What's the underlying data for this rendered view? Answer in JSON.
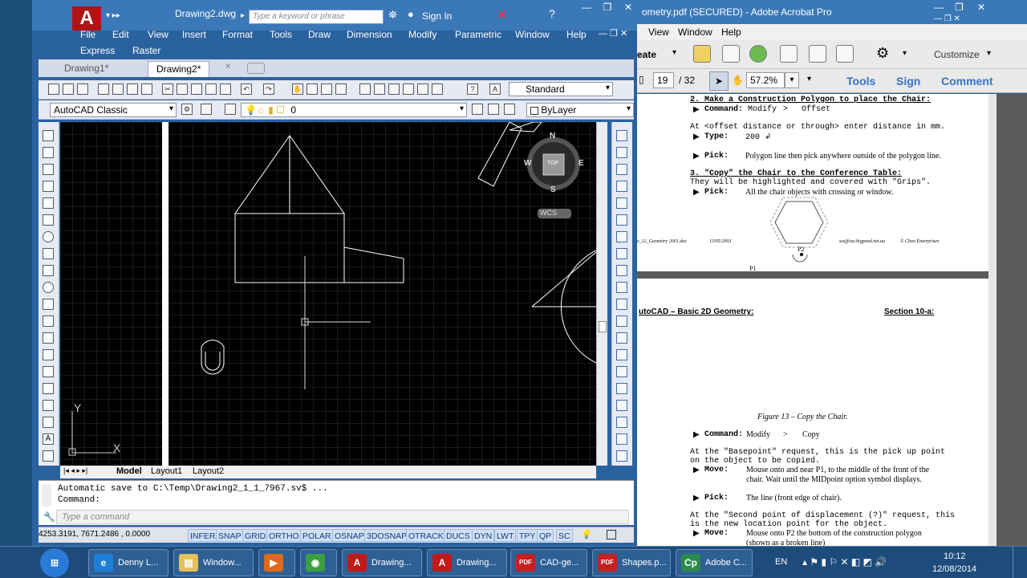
{
  "acad": {
    "doc_title": "Drawing2.dwg",
    "search_placeholder": "Type a keyword or phrase",
    "sign_in": "Sign In",
    "menu_row1": [
      "File",
      "Edit",
      "View",
      "Insert",
      "Format",
      "Tools",
      "Draw",
      "Dimension",
      "Modify",
      "Parametric",
      "Window",
      "Help"
    ],
    "menu_row2": [
      "Express",
      "Raster"
    ],
    "tabs": [
      "Drawing1*",
      "Drawing2*"
    ],
    "text_style": "Standard",
    "workspace": "AutoCAD Classic",
    "layer": "0",
    "color": "ByLayer",
    "viewcube": {
      "n": "N",
      "s": "S",
      "e": "E",
      "w": "W",
      "top": "TOP",
      "wcs": "WCS"
    },
    "ucs": {
      "x": "X",
      "y": "Y"
    },
    "layout_tabs": [
      "Model",
      "Layout1",
      "Layout2"
    ],
    "command_history": [
      "Automatic save to C:\\Temp\\Drawing2_1_1_7967.sv$ ...",
      "Command:"
    ],
    "command_placeholder": "Type a command",
    "coords": "4253.3191, 7671.2486 , 0.0000",
    "status_buttons": [
      "INFER",
      "SNAP",
      "GRID",
      "ORTHO",
      "POLAR",
      "OSNAP",
      "3DOSNAP",
      "OTRACK",
      "DUCS",
      "DYN",
      "LWT",
      "TPY",
      "QP",
      "SC"
    ]
  },
  "acro": {
    "title": "ometry.pdf (SECURED) - Adobe Acrobat Pro",
    "menu": [
      "View",
      "Window",
      "Help"
    ],
    "create_label": "eate",
    "customize": "Customize",
    "page_current": "19",
    "page_total": "/ 32",
    "zoom": "57.2%",
    "links": [
      "Tools",
      "Sign",
      "Comment"
    ],
    "page1": {
      "l1": "2. Make a Construction Polygon to place the Chair:",
      "l2a": "Command:",
      "l2b": "Modify",
      "l2c": ">",
      "l2d": "Offset",
      "l3": "At <offset distance or through> enter distance in mm.",
      "l4a": "Type:",
      "l4b": "200 ↲",
      "l5a": "Pick:",
      "l5b": "Polygon line then pick anywhere outside of the polygon line.",
      "l6": "3. \"Copy\" the Chair to the Conference Table:",
      "l7": "They will be highlighted and covered with \"Grips\".",
      "l8a": "Pick:",
      "l8b": "All the chair objects with crossing or window.",
      "p2": "P2",
      "p1": "P1",
      "footer1": "e_12_Geometry 2001.doc",
      "footer2": "13/05/2003",
      "footer3": "sss@sss.bigpond.net.au",
      "footer4": "© Choo Enterprises"
    },
    "page2": {
      "header_left": "utoCAD – Basic 2D Geometry:",
      "header_right": "Section 10-a:",
      "figure": "Figure 13 – Copy the Chair.",
      "c1a": "Command:",
      "c1b": "Modify",
      "c1c": ">",
      "c1d": "Copy",
      "c2": "At the \"Basepoint\" request, this is the pick up point",
      "c3": "on the object to be copied.",
      "c4a": "Move:",
      "c4b": "Mouse onto and near P1, to the middle of the front of the",
      "c4c": "chair. Wait until the MIDpoint option symbol displays.",
      "c5a": "Pick:",
      "c5b": "The line (front edge of chair).",
      "c6": "At the \"Second point of displacement (?)\" request, this",
      "c7": "is the new location point for the object.",
      "c8a": "Move:",
      "c8b": "Mouse onto P2 the bottom of the construction polygon",
      "c8c": "(shown as a broken line)"
    }
  },
  "taskbar": {
    "items": [
      {
        "label": "Denny L...",
        "icon": "e",
        "color": "#1e7fd8"
      },
      {
        "label": "Window...",
        "icon": "▤",
        "color": "#e4c15a"
      },
      {
        "label": "",
        "icon": "▶",
        "color": "#e06a1a"
      },
      {
        "label": "",
        "icon": "◉",
        "color": "#3aa040"
      },
      {
        "label": "Drawing...",
        "icon": "A",
        "color": "#c11a1a"
      },
      {
        "label": "Drawing...",
        "icon": "A",
        "color": "#c11a1a"
      },
      {
        "label": "CAD-ge...",
        "icon": "PDF",
        "color": "#c42020"
      },
      {
        "label": "Shapes.p...",
        "icon": "PDF",
        "color": "#c42020"
      },
      {
        "label": "Adobe C...",
        "icon": "Cp",
        "color": "#2a8a4a"
      }
    ],
    "lang": "EN",
    "time": "10:12",
    "date": "12/08/2014"
  }
}
